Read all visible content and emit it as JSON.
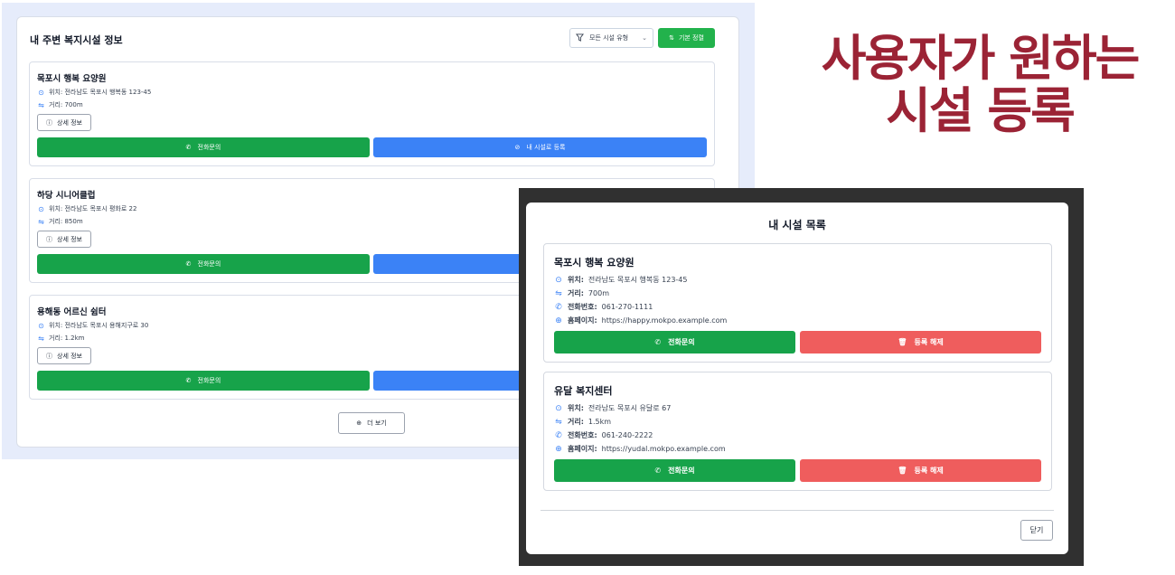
{
  "list_panel": {
    "title": "내 주변 복지시설 정보",
    "filter_label": "모든 시설 유형",
    "sort_label": "기본 정렬",
    "facilities": [
      {
        "name": "목포시 행복 요양원",
        "location": "위치: 전라남도 목포시 행복동 123-45",
        "distance": "거리: 700m",
        "detail_label": "상세 정보",
        "call_label": "전화문의",
        "register_label": "내 시설로 등록"
      },
      {
        "name": "하당 시니어클럽",
        "location": "위치: 전라남도 목포시 평화로 22",
        "distance": "거리: 850m",
        "detail_label": "상세 정보",
        "call_label": "전화문의",
        "register_label": ""
      },
      {
        "name": "용해동 어르신 쉼터",
        "location": "위치: 전라남도 목포시 용해지구로 30",
        "distance": "거리: 1.2km",
        "detail_label": "상세 정보",
        "call_label": "전화문의",
        "register_label": ""
      }
    ],
    "more_label": "더 보기"
  },
  "headline": {
    "line1": "사용자가 원하는",
    "line2": "시설 등록"
  },
  "modal": {
    "title": "내 시설 목록",
    "facilities": [
      {
        "name": "목포시 행복 요양원",
        "location_label": "위치:",
        "location": "전라남도 목포시 행복동 123-45",
        "distance_label": "거리:",
        "distance": "700m",
        "phone_label": "전화번호:",
        "phone": "061-270-1111",
        "homepage_label": "홈페이지:",
        "homepage": "https://happy.mokpo.example.com",
        "call_label": "전화문의",
        "unregister_label": "등록 해제"
      },
      {
        "name": "유달 복지센터",
        "location_label": "위치:",
        "location": "전라남도 목포시 유달로 67",
        "distance_label": "거리:",
        "distance": "1.5km",
        "phone_label": "전화번호:",
        "phone": "061-240-2222",
        "homepage_label": "홈페이지:",
        "homepage": "https://yudal.mokpo.example.com",
        "call_label": "전화문의",
        "unregister_label": "등록 해제"
      }
    ],
    "close_label": "닫기"
  },
  "colors": {
    "green": "#17a34a",
    "blue": "#3b82f6",
    "red": "#ef5d5d",
    "headline": "#9b2335"
  },
  "icons": [
    "filter-icon",
    "sort-icon",
    "location-pin-icon",
    "distance-icon",
    "info-icon",
    "phone-icon",
    "check-circle-icon",
    "plus-circle-icon",
    "globe-icon",
    "trash-icon",
    "chevron-down-icon"
  ]
}
